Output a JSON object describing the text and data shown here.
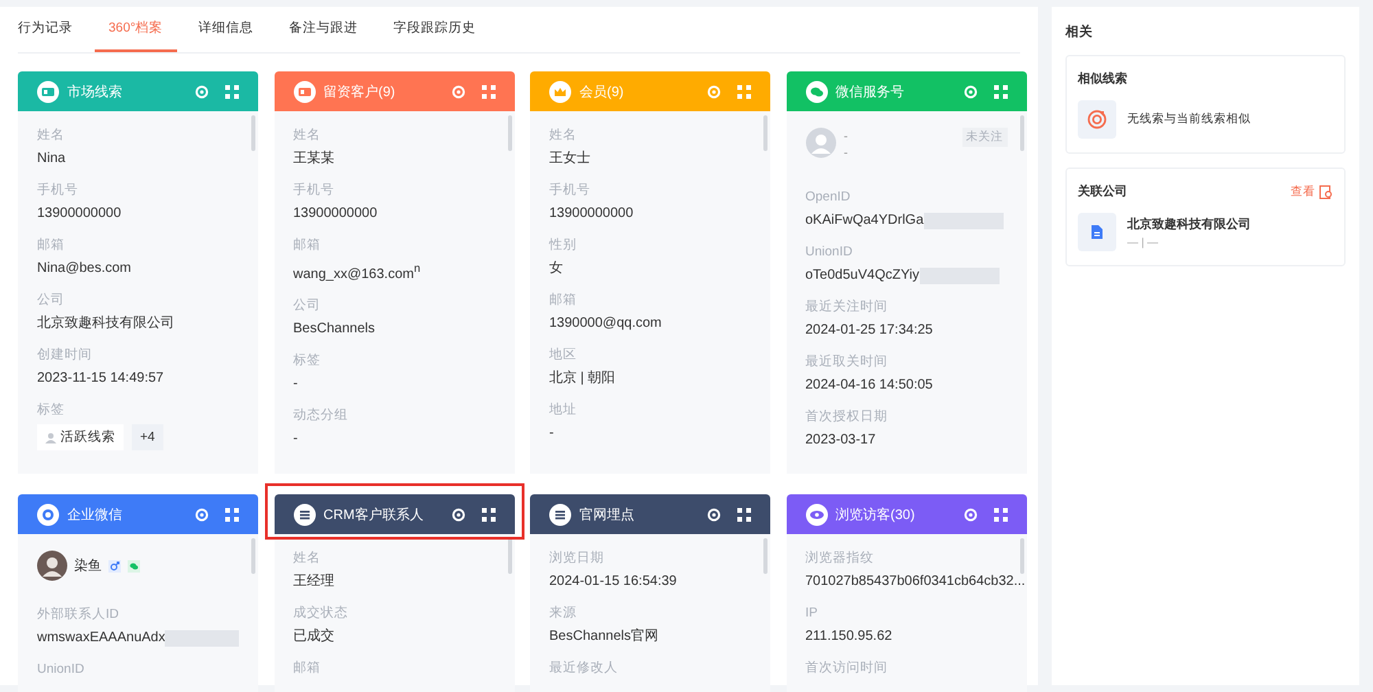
{
  "tabs": [
    {
      "label": "行为记录",
      "selected": false
    },
    {
      "label": "360°档案",
      "selected": true
    },
    {
      "label": "详细信息",
      "selected": false
    },
    {
      "label": "备注与跟进",
      "selected": false
    },
    {
      "label": "字段跟踪历史",
      "selected": false
    }
  ],
  "cards": [
    {
      "title": "市场线索",
      "color": "#1bb9a4",
      "kind": "id-card",
      "highlighted": false,
      "fields": [
        {
          "label": "姓名",
          "value": "Nina"
        },
        {
          "label": "手机号",
          "value": "13900000000"
        },
        {
          "label": "邮箱",
          "value": "Nina@bes.com"
        },
        {
          "label": "公司",
          "value": "北京致趣科技有限公司"
        },
        {
          "label": "创建时间",
          "value": "2023-11-15 14:49:57"
        },
        {
          "label": "标签",
          "tags": [
            "活跃线索",
            "+4"
          ]
        }
      ]
    },
    {
      "title": "留资客户(9)",
      "color": "#ff7452",
      "kind": "id-card",
      "highlighted": false,
      "fields": [
        {
          "label": "姓名",
          "value": "王某某"
        },
        {
          "label": "手机号",
          "value": "13900000000"
        },
        {
          "label": "邮箱",
          "value": "wang_xx@163.com$^{n}$"
        },
        {
          "label": "公司",
          "value": "BesChannels"
        },
        {
          "label": "标签",
          "value": "-"
        },
        {
          "label": "动态分组",
          "value": "-"
        }
      ]
    },
    {
      "title": "会员(9)",
      "color": "#ffab00",
      "kind": "crown",
      "highlighted": false,
      "fields": [
        {
          "label": "姓名",
          "value": "王女士"
        },
        {
          "label": "手机号",
          "value": "13900000000"
        },
        {
          "label": "性别",
          "value": "女"
        },
        {
          "label": "邮箱",
          "value": "1390000@qq.com"
        },
        {
          "label": "地区",
          "value": "北京 | 朝阳"
        },
        {
          "label": "地址",
          "value": "-"
        }
      ]
    },
    {
      "title": "微信服务号",
      "color": "#12c164",
      "kind": "wechat",
      "highlighted": false,
      "profile": {
        "name": "-",
        "sub": "-",
        "status": "未关注"
      },
      "fields": [
        {
          "label": "OpenID",
          "value": "oKAiFwQa4YDrlGa",
          "redacted": true
        },
        {
          "label": "UnionID",
          "value": "oTe0d5uV4QcZYiy",
          "redacted": true
        },
        {
          "label": "最近关注时间",
          "value": "2024-01-25 17:34:25"
        },
        {
          "label": "最近取关时间",
          "value": "2024-04-16 14:50:05"
        },
        {
          "label": "首次授权日期",
          "value": "2023-03-17"
        }
      ]
    },
    {
      "title": "企业微信",
      "color": "#3e7bf7",
      "kind": "chat",
      "highlighted": false,
      "contact": {
        "name": "染鱼"
      },
      "fields": [
        {
          "label": "外部联系人ID",
          "value": "wmswaxEAAAnuAdx",
          "redacted": true
        },
        {
          "label": "UnionID"
        }
      ]
    },
    {
      "title": "CRM客户联系人",
      "color": "#3d4c6b",
      "kind": "list",
      "highlighted": true,
      "fields": [
        {
          "label": "姓名",
          "value": "王经理"
        },
        {
          "label": "成交状态",
          "value": "已成交"
        },
        {
          "label": "邮箱"
        }
      ]
    },
    {
      "title": "官网埋点",
      "color": "#3d4c6b",
      "kind": "list",
      "highlighted": false,
      "fields": [
        {
          "label": "浏览日期",
          "value": "2024-01-15 16:54:39"
        },
        {
          "label": "来源",
          "value": "BesChannels官网"
        },
        {
          "label": "最近修改人"
        }
      ]
    },
    {
      "title": "浏览访客(30)",
      "color": "#7c5cf5",
      "kind": "eye",
      "highlighted": false,
      "fields": [
        {
          "label": "浏览器指纹",
          "value": "701027b85437b06f0341cb64cb32..."
        },
        {
          "label": "IP",
          "value": "211.150.95.62"
        },
        {
          "label": "首次访问时间"
        }
      ]
    }
  ],
  "related": {
    "title": "相关",
    "similar": {
      "title": "相似线索",
      "message": "无线索与当前线索相似"
    },
    "company": {
      "title": "关联公司",
      "link": "查看",
      "name": "北京致趣科技有限公司",
      "sub": "— | —"
    }
  }
}
